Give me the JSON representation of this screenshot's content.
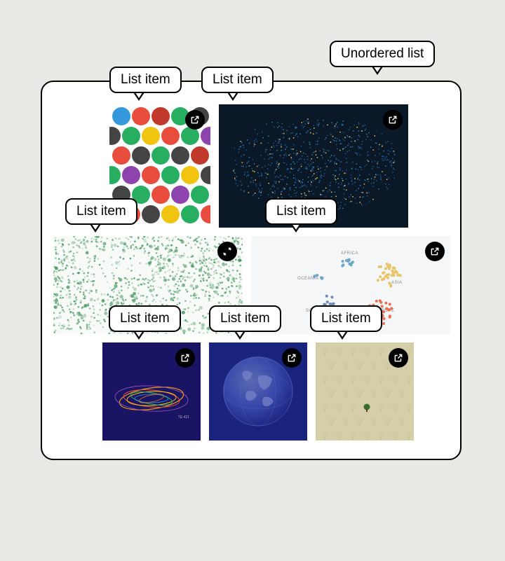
{
  "labels": {
    "container": "Unordered list",
    "items": [
      "List item",
      "List item",
      "List item",
      "List item",
      "List item",
      "List item",
      "List item"
    ]
  },
  "tiles": {
    "tile4": {
      "continents": [
        "AFRICA",
        "OCEANIA",
        "ASIA",
        "SOUTH AMERICA",
        "EUROPE"
      ]
    },
    "tile5": {
      "caption": "TE-421"
    }
  }
}
